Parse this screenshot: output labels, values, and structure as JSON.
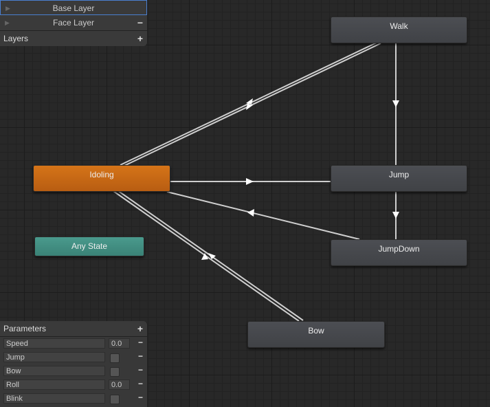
{
  "layers": {
    "items": [
      {
        "label": "Base Layer",
        "selected": true
      },
      {
        "label": "Face Layer"
      }
    ],
    "header": "Layers",
    "add": "+",
    "remove": "−"
  },
  "states": {
    "walk": "Walk",
    "jump": "Jump",
    "jumpdown": "JumpDown",
    "bow": "Bow",
    "idoling": "Idoling",
    "any": "Any State"
  },
  "colors": {
    "default_state": "#c8691a",
    "any_state": "#3f8c80",
    "node": "#46484c"
  },
  "parameters": {
    "header": "Parameters",
    "add": "+",
    "remove": "−",
    "items": [
      {
        "name": "Speed",
        "type": "float",
        "value": "0.0"
      },
      {
        "name": "Jump",
        "type": "bool",
        "value": false
      },
      {
        "name": "Bow",
        "type": "bool",
        "value": false
      },
      {
        "name": "Roll",
        "type": "float",
        "value": "0.0"
      },
      {
        "name": "Blink",
        "type": "bool",
        "value": false
      }
    ]
  }
}
